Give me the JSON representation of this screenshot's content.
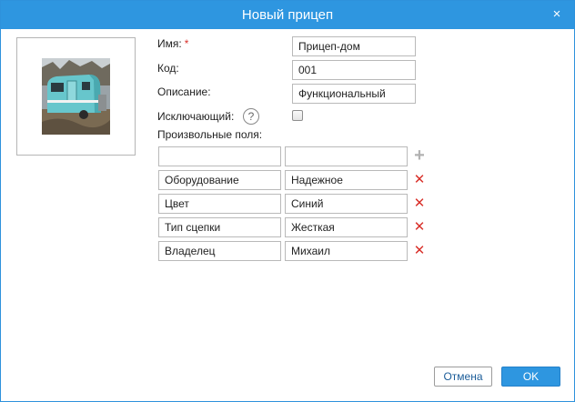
{
  "dialog": {
    "title": "Новый прицеп",
    "close_glyph": "×"
  },
  "form": {
    "name_label": "Имя:",
    "required_mark": "*",
    "name_value": "Прицеп-дом",
    "code_label": "Код:",
    "code_value": "001",
    "description_label": "Описание:",
    "description_value": "Функциональный",
    "exclusive_label": "Исключающий:",
    "exclusive_checked": false,
    "help_glyph": "?",
    "custom_fields_label": "Произвольные поля:"
  },
  "custom_fields": [
    {
      "key": "Оборудование",
      "value": "Надежное"
    },
    {
      "key": "Цвет",
      "value": "Синий"
    },
    {
      "key": "Тип сцепки",
      "value": "Жесткая"
    },
    {
      "key": "Владелец",
      "value": "Михаил"
    }
  ],
  "icons": {
    "add": "+",
    "delete": "✕"
  },
  "buttons": {
    "cancel": "Отмена",
    "ok": "OK"
  },
  "colors": {
    "titlebar": "#2e96e0",
    "required": "#d9312b",
    "delete_icon": "#d9312b",
    "add_icon": "#b2b2b2",
    "ok_button": "#2e96e0"
  }
}
